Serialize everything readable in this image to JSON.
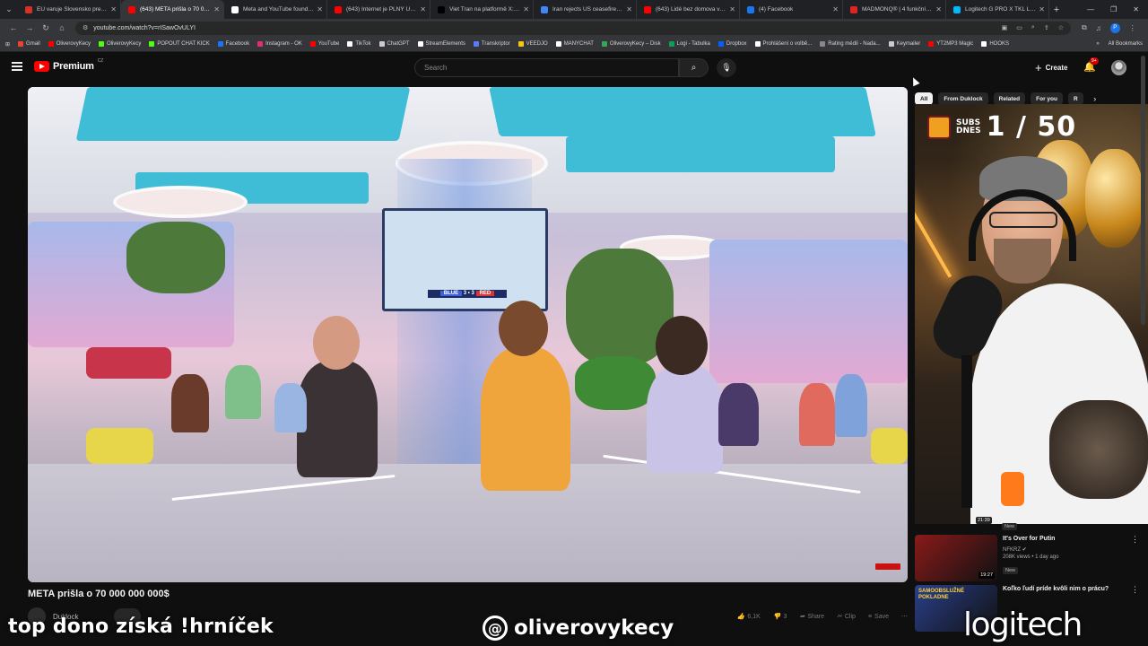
{
  "browser": {
    "tabs": [
      {
        "title": "EU varuje Slovensko pred ne:",
        "color": "#d93025"
      },
      {
        "title": "(643) META prišla o 70 000 0",
        "color": "#ff0000",
        "active": true
      },
      {
        "title": "Meta and YouTube found liab",
        "color": "#ffffff"
      },
      {
        "title": "(643) Internet je PLNÝ ÚCHYL",
        "color": "#ff0000"
      },
      {
        "title": "Viet Tran na platformě X: „S",
        "color": "#000000"
      },
      {
        "title": "Iran rejects US ceasefire plan",
        "color": "#4285f4"
      },
      {
        "title": "(643) Lidé bez domova v rám",
        "color": "#ff0000"
      },
      {
        "title": "(4) Facebook",
        "color": "#1877f2"
      },
      {
        "title": "MADMONQ® | 4 funkční doplň",
        "color": "#e02424"
      },
      {
        "title": "Logitech G PRO X TKL LIGHTS",
        "color": "#00b8fc"
      }
    ],
    "url": "youtube.com/watch?v=rISawOvULYI",
    "bookmarks": [
      {
        "label": "Gmail",
        "color": "#ea4335"
      },
      {
        "label": "OliverovyKecy",
        "color": "#ff0000"
      },
      {
        "label": "OliverovyKecy",
        "color": "#53fc18"
      },
      {
        "label": "POPOUT CHAT KICK",
        "color": "#53fc18"
      },
      {
        "label": "Facebook",
        "color": "#1877f2"
      },
      {
        "label": "Instagram - OK",
        "color": "#e1306c"
      },
      {
        "label": "YouTube",
        "color": "#ff0000"
      },
      {
        "label": "TikTok",
        "color": "#ffffff"
      },
      {
        "label": "ChatGPT",
        "color": "#cccccc"
      },
      {
        "label": "StreamElements",
        "color": "#ffffff"
      },
      {
        "label": "Transkriptor",
        "color": "#5b7cfa"
      },
      {
        "label": "VEEDJO",
        "color": "#f5c518"
      },
      {
        "label": "MANYCHAT",
        "color": "#ffffff"
      },
      {
        "label": "OliverovyKecy – Disk",
        "color": "#34a853"
      },
      {
        "label": "Logi - Tabulka",
        "color": "#0f9d58"
      },
      {
        "label": "Dropbox",
        "color": "#0061ff"
      },
      {
        "label": "Prohlášení o volbě...",
        "color": "#ffffff"
      },
      {
        "label": "Rating médií - Nada...",
        "color": "#888888"
      },
      {
        "label": "Keymailer",
        "color": "#cccccc"
      },
      {
        "label": "YT2MP3 Magic",
        "color": "#ff0000"
      },
      {
        "label": "HOOKS",
        "color": "#ffffff"
      }
    ],
    "all_bookmarks": "All Bookmarks"
  },
  "masthead": {
    "logo_text": "Premium",
    "country_code": "CZ",
    "search_placeholder": "Search",
    "create_label": "Create",
    "notification_badge": "9+"
  },
  "video": {
    "title": "META prišla o 70 000 000 000$",
    "channel": "Duklock",
    "score_blue": "BLUE",
    "score_value": "3 • 3",
    "score_red": "RED",
    "likes": "6,1K",
    "dislike_count": "3",
    "share_label": "Share",
    "clip_label": "Clip",
    "save_label": "Save"
  },
  "sidebar": {
    "chips": [
      {
        "label": "All",
        "active": true
      },
      {
        "label": "From Duklock"
      },
      {
        "label": "Related"
      },
      {
        "label": "For you"
      },
      {
        "label": "R"
      }
    ],
    "subs_label_line1": "SUBS",
    "subs_label_line2": "DNES",
    "subs_counter": "1 / 50",
    "top_new_tag": "New",
    "top_duration": "21:39",
    "recommendations": [
      {
        "title": "It's Over for Putin",
        "channel": "NFKRZ",
        "meta": "208K views • 1 day ago",
        "badge": "New",
        "duration": "19:27",
        "thumb": "#8a1a1a"
      },
      {
        "title": "Koľko ľudí príde kvôli nim o prácu?",
        "channel": "",
        "meta": "",
        "badge": "",
        "duration": "",
        "thumb": "#2a3f8a",
        "thumb_text": "SAMOOBSLUŽNÉ POKLADNE"
      }
    ]
  },
  "overlays": {
    "chat_command": "top dono získá !hrníček",
    "social_handle": "oliverovykecy",
    "sponsor": "logitech"
  }
}
